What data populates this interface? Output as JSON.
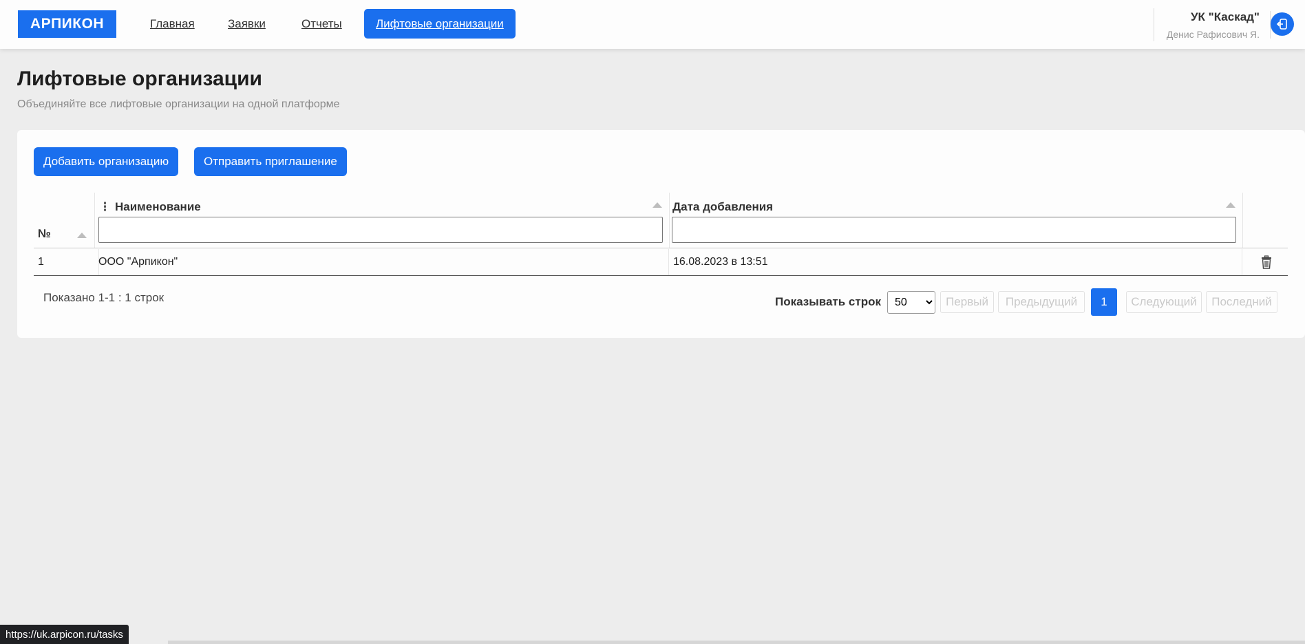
{
  "header": {
    "logo": "АРПИКОН",
    "nav": [
      {
        "label": "Главная"
      },
      {
        "label": "Заявки"
      },
      {
        "label": "Отчеты"
      },
      {
        "label": "Лифтовые организации",
        "active": true
      }
    ],
    "org_name": "УК \"Каскад\"",
    "user_name": "Денис Рафисович Я.",
    "logout_icon": "logout-icon"
  },
  "page": {
    "title": "Лифтовые организации",
    "subtitle": "Объединяйте все лифтовые организации на одной платформе"
  },
  "actions": {
    "add_label": "Добавить организацию",
    "invite_label": "Отправить приглашение"
  },
  "table": {
    "columns": {
      "no": "№",
      "name": "Наименование",
      "date": "Дата добавления"
    },
    "filters": {
      "name_value": "",
      "date_value": ""
    },
    "rows": [
      {
        "no": "1",
        "name": "ООО \"Арпикон\"",
        "date": "16.08.2023 в 13:51"
      }
    ]
  },
  "pagination": {
    "shown": "Показано 1-1 : 1 строк",
    "rows_label": "Показывать строк",
    "rows_value": "50",
    "first": "Первый",
    "prev": "Предыдущий",
    "current": "1",
    "next": "Следующий",
    "last": "Последний"
  },
  "status_bar": {
    "url": "https://uk.arpicon.ru/tasks"
  },
  "colors": {
    "accent": "#1a6fee",
    "background": "#ededed",
    "card": "#fdfdfd"
  }
}
